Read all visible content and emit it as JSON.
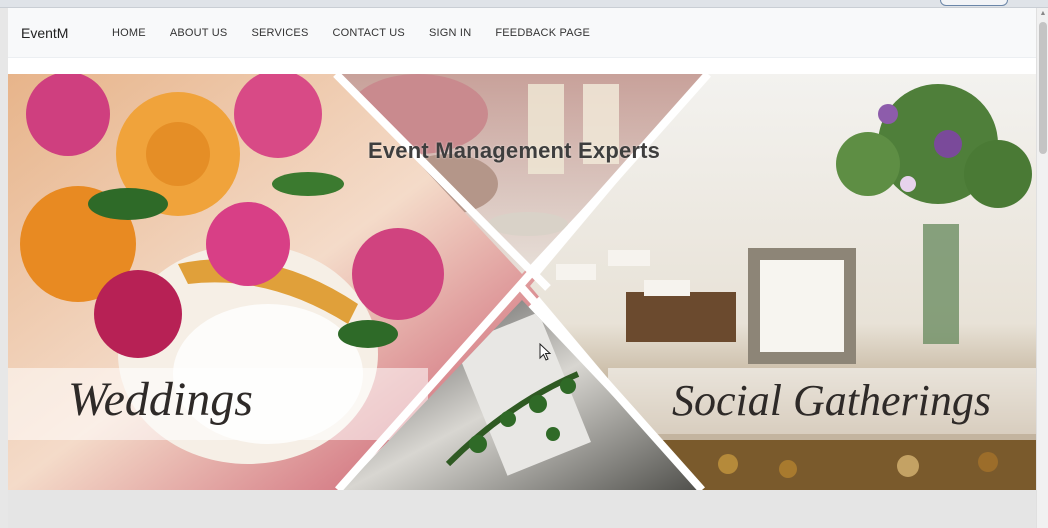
{
  "navbar": {
    "brand": "EventM",
    "links": [
      {
        "label": "HOME"
      },
      {
        "label": "ABOUT US"
      },
      {
        "label": "SERVICES"
      },
      {
        "label": "CONTACT US"
      },
      {
        "label": "SIGN IN"
      },
      {
        "label": "FEEDBACK PAGE"
      }
    ]
  },
  "hero": {
    "title": "Event Management Experts",
    "panels": {
      "left_caption": "Weddings",
      "right_caption": "Social Gatherings"
    }
  },
  "icons": {
    "cursor": "arrow-cursor-icon",
    "scroll_up": "chevron-up-icon"
  },
  "colors": {
    "navbar_bg": "#f8f9fa",
    "page_bg": "#ffffff",
    "footer_band": "#e5e5e5",
    "title_text": "#3e3e3e"
  }
}
